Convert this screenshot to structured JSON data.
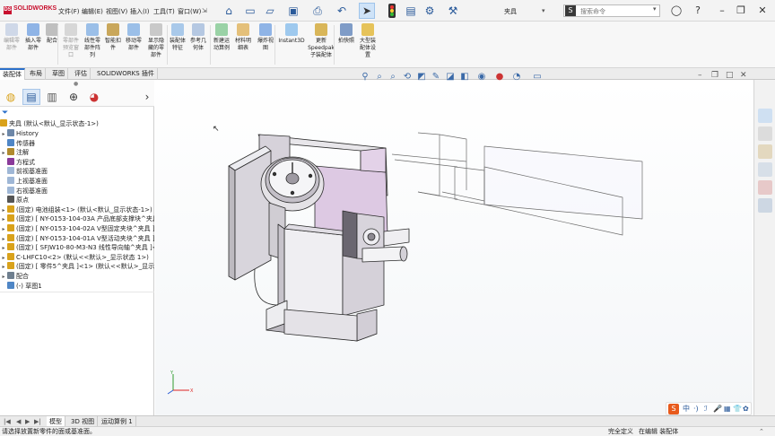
{
  "app": {
    "logo_text": "SOLIDWORKS",
    "logo_mark": "DS",
    "document_title": "夹具"
  },
  "menu": [
    "文件(F)",
    "编辑(E)",
    "视图(V)",
    "插入(I)",
    "工具(T)",
    "窗口(W)"
  ],
  "search": {
    "placeholder": "搜索命令",
    "button_icon": "S",
    "arrow": "▾"
  },
  "ribbon": [
    {
      "label": "编辑零\n部件",
      "disabled": true
    },
    {
      "label": "插入零\n部件",
      "disabled": false
    },
    {
      "label": "配合",
      "disabled": false
    },
    {
      "label": "零部件\n预览窗\n口",
      "disabled": true
    },
    {
      "label": "线性零\n部件阵\n列",
      "disabled": false
    },
    {
      "label": "智能扣\n件",
      "disabled": false
    },
    {
      "label": "移动零\n部件",
      "disabled": false
    },
    {
      "label": "显示隐\n藏的零\n部件",
      "disabled": false
    },
    {
      "label": "装配体\n特征",
      "disabled": false
    },
    {
      "label": "参考几\n何体",
      "disabled": false
    },
    {
      "label": "新建运\n动算例",
      "disabled": false
    },
    {
      "label": "材料明\n细表",
      "disabled": false
    },
    {
      "label": "爆炸视\n图",
      "disabled": false
    },
    {
      "label": "Instant3D",
      "disabled": false
    },
    {
      "label": "更新\nSpeedpak\n子装配体",
      "disabled": false
    },
    {
      "label": "拍快照",
      "disabled": false
    },
    {
      "label": "大型装\n配体设\n置",
      "disabled": false
    }
  ],
  "tabs": [
    "装配体",
    "布局",
    "草图",
    "评估",
    "SOLIDWORKS 插件"
  ],
  "tree": {
    "root": "夹具  (默认<默认_显示状态-1>)",
    "items": [
      {
        "label": "History",
        "expander": "▸",
        "color": "#6d87a8"
      },
      {
        "label": "传感器",
        "expander": "",
        "color": "#4f86c6"
      },
      {
        "label": "注解",
        "expander": "▸",
        "color": "#b08a2e"
      },
      {
        "label": "方程式",
        "expander": "",
        "color": "#8a3a9a"
      },
      {
        "label": "前视基准面",
        "expander": "",
        "color": "#9fb7d6"
      },
      {
        "label": "上视基准面",
        "expander": "",
        "color": "#9fb7d6"
      },
      {
        "label": "右视基准面",
        "expander": "",
        "color": "#9fb7d6"
      },
      {
        "label": "原点",
        "expander": "",
        "color": "#555555"
      },
      {
        "label": "(固定) 电池组装<1> (默认<默认_显示状态-1>)",
        "expander": "▸",
        "color": "#d9a21b"
      },
      {
        "label": "(固定) [ NY-0153-104-03A 产品底部支撑块^夹具 ]",
        "expander": "▸",
        "color": "#d9a21b"
      },
      {
        "label": "(固定) [ NY-0153-104-02A V型固定夹块^夹具 ]<",
        "expander": "▸",
        "color": "#d9a21b"
      },
      {
        "label": "(固定) [ NY-0153-104-01A V型活动夹块^夹具 ]<",
        "expander": "▸",
        "color": "#d9a21b"
      },
      {
        "label": "(固定) [ SFJW10-80-M3-N3 线性导向轴^夹具 ]<",
        "expander": "▸",
        "color": "#d9a21b"
      },
      {
        "label": "C-LHFC10<2> (默认<<默认>_显示状态 1>)",
        "expander": "▸",
        "color": "#d9a21b"
      },
      {
        "label": "(固定) [ 零件5^夹具 ]<1> (默认<<默认>_显示状",
        "expander": "▸",
        "color": "#d9a21b"
      },
      {
        "label": "配合",
        "expander": "▸",
        "color": "#6f7f8f"
      },
      {
        "label": "(-) 草图1",
        "expander": "",
        "color": "#4f86c6"
      }
    ]
  },
  "filter_icon": "filter-icon",
  "bottom_tabs": [
    "模型",
    "3D 视图",
    "运动算例 1"
  ],
  "status": {
    "left": "请选择放置新零件的面或基准面。",
    "mid": "完全定义",
    "right": "在编辑 装配体"
  },
  "ime": {
    "s_label": "S",
    "zh": "中",
    "items": [
      "·)",
      "ℐ",
      "🎤",
      "▦",
      "👕",
      "✿"
    ]
  },
  "colors": {
    "accent": "#2a6fc9",
    "brand": "#c8102e",
    "tree_icon": "#d9a21b"
  }
}
